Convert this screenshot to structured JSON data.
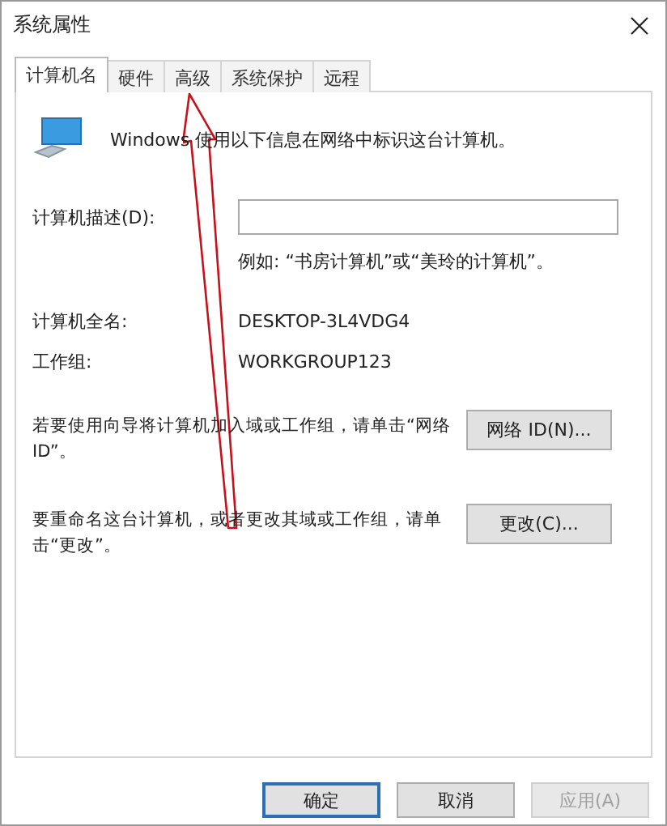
{
  "window": {
    "title": "系统属性"
  },
  "tabs": [
    {
      "label": "计算机名",
      "selected": true
    },
    {
      "label": "硬件",
      "selected": false
    },
    {
      "label": "高级",
      "selected": false
    },
    {
      "label": "系统保护",
      "selected": false
    },
    {
      "label": "远程",
      "selected": false
    }
  ],
  "intro": "Windows 使用以下信息在网络中标识这台计算机。",
  "description": {
    "label": "计算机描述(D):",
    "hint": "例如: “书房计算机”或“美玲的计算机”。"
  },
  "info": [
    {
      "label": "计算机全名:",
      "value": "DESKTOP-3L4VDG4"
    },
    {
      "label": "工作组:",
      "value": "WORKGROUP123"
    }
  ],
  "actions": [
    {
      "text": "若要使用向导将计算机加入域或工作组，请单击“网络 ID”。",
      "button": "网络 ID(N)..."
    },
    {
      "text": "要重命名这台计算机，或者更改其域或工作组，请单击“更改”。",
      "button": "更改(C)..."
    }
  ],
  "buttons": [
    {
      "label": "确定",
      "kind": "default",
      "disabled": false
    },
    {
      "label": "取消",
      "kind": "normal",
      "disabled": false
    },
    {
      "label": "应用(A)",
      "kind": "normal",
      "disabled": true
    }
  ]
}
